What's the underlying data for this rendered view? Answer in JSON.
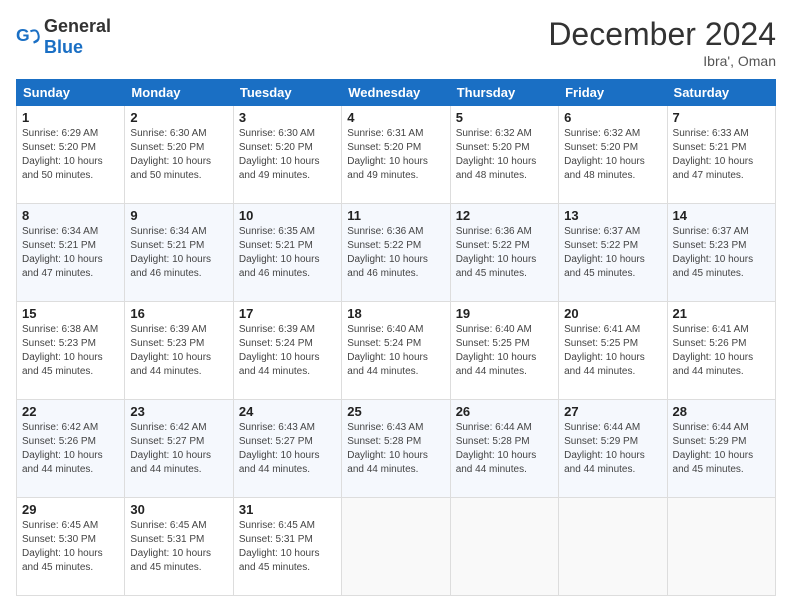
{
  "logo": {
    "general": "General",
    "blue": "Blue"
  },
  "header": {
    "month": "December 2024",
    "location": "Ibra', Oman"
  },
  "weekdays": [
    "Sunday",
    "Monday",
    "Tuesday",
    "Wednesday",
    "Thursday",
    "Friday",
    "Saturday"
  ],
  "weeks": [
    [
      {
        "day": "1",
        "sunrise": "6:29 AM",
        "sunset": "5:20 PM",
        "daylight": "10 hours and 50 minutes."
      },
      {
        "day": "2",
        "sunrise": "6:30 AM",
        "sunset": "5:20 PM",
        "daylight": "10 hours and 50 minutes."
      },
      {
        "day": "3",
        "sunrise": "6:30 AM",
        "sunset": "5:20 PM",
        "daylight": "10 hours and 49 minutes."
      },
      {
        "day": "4",
        "sunrise": "6:31 AM",
        "sunset": "5:20 PM",
        "daylight": "10 hours and 49 minutes."
      },
      {
        "day": "5",
        "sunrise": "6:32 AM",
        "sunset": "5:20 PM",
        "daylight": "10 hours and 48 minutes."
      },
      {
        "day": "6",
        "sunrise": "6:32 AM",
        "sunset": "5:20 PM",
        "daylight": "10 hours and 48 minutes."
      },
      {
        "day": "7",
        "sunrise": "6:33 AM",
        "sunset": "5:21 PM",
        "daylight": "10 hours and 47 minutes."
      }
    ],
    [
      {
        "day": "8",
        "sunrise": "6:34 AM",
        "sunset": "5:21 PM",
        "daylight": "10 hours and 47 minutes."
      },
      {
        "day": "9",
        "sunrise": "6:34 AM",
        "sunset": "5:21 PM",
        "daylight": "10 hours and 46 minutes."
      },
      {
        "day": "10",
        "sunrise": "6:35 AM",
        "sunset": "5:21 PM",
        "daylight": "10 hours and 46 minutes."
      },
      {
        "day": "11",
        "sunrise": "6:36 AM",
        "sunset": "5:22 PM",
        "daylight": "10 hours and 46 minutes."
      },
      {
        "day": "12",
        "sunrise": "6:36 AM",
        "sunset": "5:22 PM",
        "daylight": "10 hours and 45 minutes."
      },
      {
        "day": "13",
        "sunrise": "6:37 AM",
        "sunset": "5:22 PM",
        "daylight": "10 hours and 45 minutes."
      },
      {
        "day": "14",
        "sunrise": "6:37 AM",
        "sunset": "5:23 PM",
        "daylight": "10 hours and 45 minutes."
      }
    ],
    [
      {
        "day": "15",
        "sunrise": "6:38 AM",
        "sunset": "5:23 PM",
        "daylight": "10 hours and 45 minutes."
      },
      {
        "day": "16",
        "sunrise": "6:39 AM",
        "sunset": "5:23 PM",
        "daylight": "10 hours and 44 minutes."
      },
      {
        "day": "17",
        "sunrise": "6:39 AM",
        "sunset": "5:24 PM",
        "daylight": "10 hours and 44 minutes."
      },
      {
        "day": "18",
        "sunrise": "6:40 AM",
        "sunset": "5:24 PM",
        "daylight": "10 hours and 44 minutes."
      },
      {
        "day": "19",
        "sunrise": "6:40 AM",
        "sunset": "5:25 PM",
        "daylight": "10 hours and 44 minutes."
      },
      {
        "day": "20",
        "sunrise": "6:41 AM",
        "sunset": "5:25 PM",
        "daylight": "10 hours and 44 minutes."
      },
      {
        "day": "21",
        "sunrise": "6:41 AM",
        "sunset": "5:26 PM",
        "daylight": "10 hours and 44 minutes."
      }
    ],
    [
      {
        "day": "22",
        "sunrise": "6:42 AM",
        "sunset": "5:26 PM",
        "daylight": "10 hours and 44 minutes."
      },
      {
        "day": "23",
        "sunrise": "6:42 AM",
        "sunset": "5:27 PM",
        "daylight": "10 hours and 44 minutes."
      },
      {
        "day": "24",
        "sunrise": "6:43 AM",
        "sunset": "5:27 PM",
        "daylight": "10 hours and 44 minutes."
      },
      {
        "day": "25",
        "sunrise": "6:43 AM",
        "sunset": "5:28 PM",
        "daylight": "10 hours and 44 minutes."
      },
      {
        "day": "26",
        "sunrise": "6:44 AM",
        "sunset": "5:28 PM",
        "daylight": "10 hours and 44 minutes."
      },
      {
        "day": "27",
        "sunrise": "6:44 AM",
        "sunset": "5:29 PM",
        "daylight": "10 hours and 44 minutes."
      },
      {
        "day": "28",
        "sunrise": "6:44 AM",
        "sunset": "5:29 PM",
        "daylight": "10 hours and 45 minutes."
      }
    ],
    [
      {
        "day": "29",
        "sunrise": "6:45 AM",
        "sunset": "5:30 PM",
        "daylight": "10 hours and 45 minutes."
      },
      {
        "day": "30",
        "sunrise": "6:45 AM",
        "sunset": "5:31 PM",
        "daylight": "10 hours and 45 minutes."
      },
      {
        "day": "31",
        "sunrise": "6:45 AM",
        "sunset": "5:31 PM",
        "daylight": "10 hours and 45 minutes."
      },
      null,
      null,
      null,
      null
    ]
  ],
  "labels": {
    "sunrise": "Sunrise:",
    "sunset": "Sunset:",
    "daylight": "Daylight:"
  }
}
